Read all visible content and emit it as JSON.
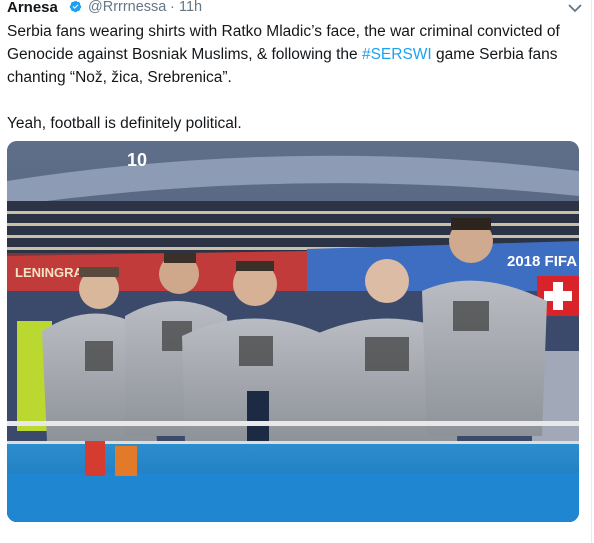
{
  "tweet": {
    "author_name": "Arnesa",
    "handle": "@Rrrrnessa",
    "separator": "·",
    "time": "11h",
    "text_before_hashtag": "Serbia fans wearing shirts with Ratko Mladic’s face, the war criminal convicted of Genocide against Bosniak Muslims, & following the ",
    "hashtag": "#SERSWI",
    "text_after_hashtag": " game Serbia fans chanting “Nož, žica, Srebrenica”.\n\nYeah, football is definitely political.",
    "media_alt": "",
    "icons": {
      "verified": "verified-badge-icon",
      "menu": "chevron-down-icon"
    },
    "colors": {
      "link": "#1da1f2",
      "verified": "#1da1f2",
      "secondary_text": "#657786"
    }
  },
  "photo": {
    "stadium_banner_text": "2018 FIFA W",
    "stadium_sign_text": "LENINGRAD",
    "stand_number": "10"
  }
}
